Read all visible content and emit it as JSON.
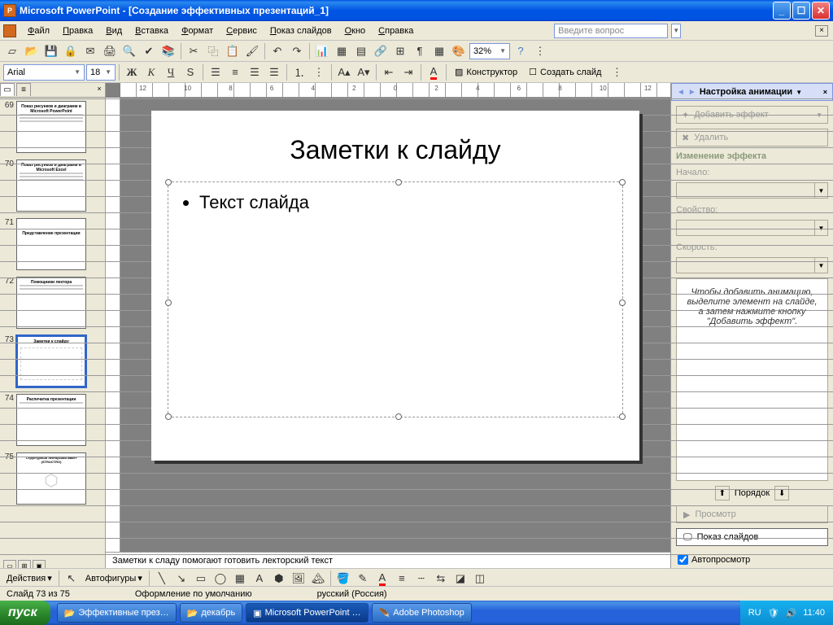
{
  "titlebar": {
    "app": "Microsoft PowerPoint",
    "doc": "[Создание эффективных презентаций_1]"
  },
  "menu": {
    "items": [
      "Файл",
      "Правка",
      "Вид",
      "Вставка",
      "Формат",
      "Сервис",
      "Показ слайдов",
      "Окно",
      "Справка"
    ],
    "ask_placeholder": "Введите вопрос"
  },
  "toolbar1": {
    "zoom": "32%"
  },
  "toolbar2": {
    "font": "Arial",
    "size": "18",
    "designer": "Конструктор",
    "new_slide": "Создать слайд"
  },
  "thumbnails": {
    "items": [
      {
        "n": 69,
        "title": "Показ рисунков и диаграмм в Microsoft PowerPoint"
      },
      {
        "n": 70,
        "title": "Показ рисунков и диаграмм в Microsoft Excel"
      },
      {
        "n": 71,
        "title": "Представление презентации"
      },
      {
        "n": 72,
        "title": "Помощники лектора"
      },
      {
        "n": 73,
        "title": "Заметки к слайду",
        "selected": true
      },
      {
        "n": 74,
        "title": "Распечатка презентации"
      },
      {
        "n": 75,
        "title": "Структурный лекторский макет (STRUCTRO)"
      }
    ]
  },
  "slide": {
    "title": "Заметки к слайду",
    "bullet1": "Текст слайда"
  },
  "notes": "Заметки к сладу помогают готовить лекторский текст",
  "taskpane": {
    "title": "Настройка анимации",
    "add_effect": "Добавить эффект",
    "delete": "Удалить",
    "change_section": "Изменение эффекта",
    "start_label": "Начало:",
    "property_label": "Свойство:",
    "speed_label": "Скорость:",
    "hint": "Чтобы добавить анимацию, выделите элемент на слайде, а затем нажмите кнопку \"Добавить эффект\".",
    "order": "Порядок",
    "preview": "Просмотр",
    "slideshow": "Показ слайдов",
    "autopreview": "Автопросмотр"
  },
  "drawbar": {
    "actions": "Действия",
    "autoshapes": "Автофигуры"
  },
  "status": {
    "slide": "Слайд 73 из 75",
    "design": "Оформление по умолчанию",
    "lang": "русский (Россия)"
  },
  "taskbar": {
    "start": "пуск",
    "items": [
      "Эффективные през…",
      "декабрь",
      "Microsoft PowerPoint …",
      "Adobe Photoshop"
    ],
    "lang": "RU",
    "time": "11:40"
  }
}
